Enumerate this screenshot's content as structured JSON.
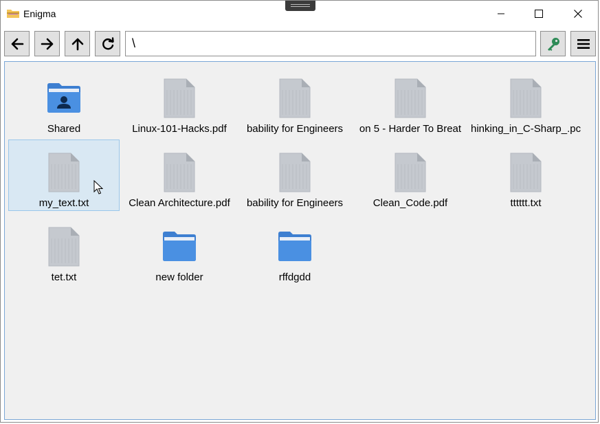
{
  "window": {
    "title": "Enigma",
    "app_icon": "folder-icon"
  },
  "toolbar": {
    "buttons": [
      "arrow-left-icon",
      "arrow-right-icon",
      "arrow-up-icon",
      "refresh-icon"
    ],
    "address": "\\",
    "key_icon": "key-icon",
    "menu_icon": "hamburger-menu-icon",
    "key_color": "#2e8b57"
  },
  "items": [
    {
      "label": "Shared",
      "type": "shared-folder"
    },
    {
      "label": "Linux-101-Hacks.pdf",
      "type": "file"
    },
    {
      "label": "bability for Engineers",
      "type": "file"
    },
    {
      "label": "on 5 - Harder To Breat",
      "type": "file"
    },
    {
      "label": "hinking_in_C-Sharp_.pc",
      "type": "file"
    },
    {
      "label": "my_text.txt",
      "type": "file",
      "selected": true
    },
    {
      "label": "Clean Architecture.pdf",
      "type": "file"
    },
    {
      "label": "bability for Engineers",
      "type": "file"
    },
    {
      "label": "Clean_Code.pdf",
      "type": "file"
    },
    {
      "label": "tttttt.txt",
      "type": "file"
    },
    {
      "label": "tet.txt",
      "type": "file"
    },
    {
      "label": "new folder",
      "type": "folder"
    },
    {
      "label": "rffdgdd",
      "type": "folder"
    }
  ],
  "colors": {
    "folder": "#4a90e2",
    "file": "#c5c9cf",
    "selection": "#d9e8f3"
  }
}
